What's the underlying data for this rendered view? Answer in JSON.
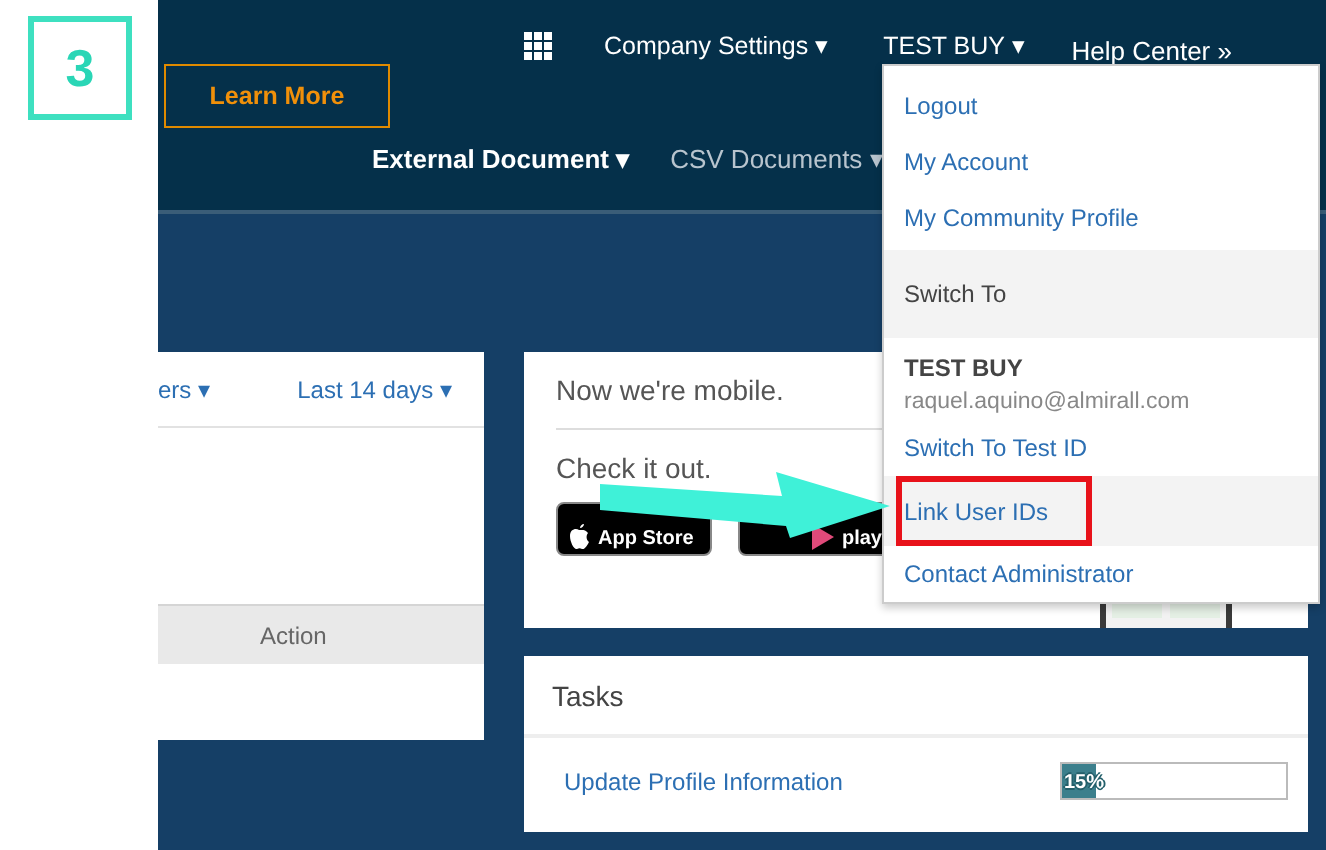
{
  "step_badge": "3",
  "header": {
    "learn_more": "Learn More",
    "top_nav": [
      {
        "label": "Company Settings",
        "caret": "▾"
      },
      {
        "label": "TEST BUY",
        "caret": "▾"
      },
      {
        "label": "Help Center",
        "caret": "»"
      }
    ],
    "second_nav": [
      {
        "label": "External Document",
        "caret": "▾"
      },
      {
        "label": "CSV Documents",
        "caret": "▾"
      }
    ]
  },
  "dropdown": [
    {
      "kind": "link",
      "label": "Logout",
      "hovered": false,
      "highlighted": false
    },
    {
      "kind": "link",
      "label": "My Account",
      "hovered": false,
      "highlighted": false
    },
    {
      "kind": "link",
      "label": "My Community Profile",
      "hovered": false,
      "highlighted": false
    },
    {
      "kind": "section",
      "label": "Switch To",
      "hovered": false,
      "highlighted": false
    },
    {
      "kind": "user",
      "label": "TEST BUY",
      "email": "raquel.aquino@almirall.com",
      "hovered": false,
      "highlighted": false
    },
    {
      "kind": "link",
      "label": "Switch To Test ID",
      "hovered": false,
      "highlighted": false
    },
    {
      "kind": "link",
      "label": "Link User IDs",
      "hovered": true,
      "highlighted": true
    },
    {
      "kind": "link",
      "label": "Contact Administrator",
      "hovered": false,
      "highlighted": false
    }
  ],
  "left_card": {
    "filters": [
      {
        "label": "ers",
        "caret": "▾"
      },
      {
        "label": "Last 14 days",
        "caret": "▾"
      }
    ],
    "columns": [
      "Action"
    ]
  },
  "mobile_card": {
    "title": "Now we're mobile.",
    "subtitle": "Check it out.",
    "stores": [
      {
        "kind": "apple",
        "label": "App Store"
      },
      {
        "kind": "google",
        "label": "play"
      }
    ]
  },
  "tasks": {
    "title": "Tasks",
    "items": [
      {
        "label": "Update Profile Information",
        "level": 0.15,
        "reading": "15%"
      }
    ]
  }
}
